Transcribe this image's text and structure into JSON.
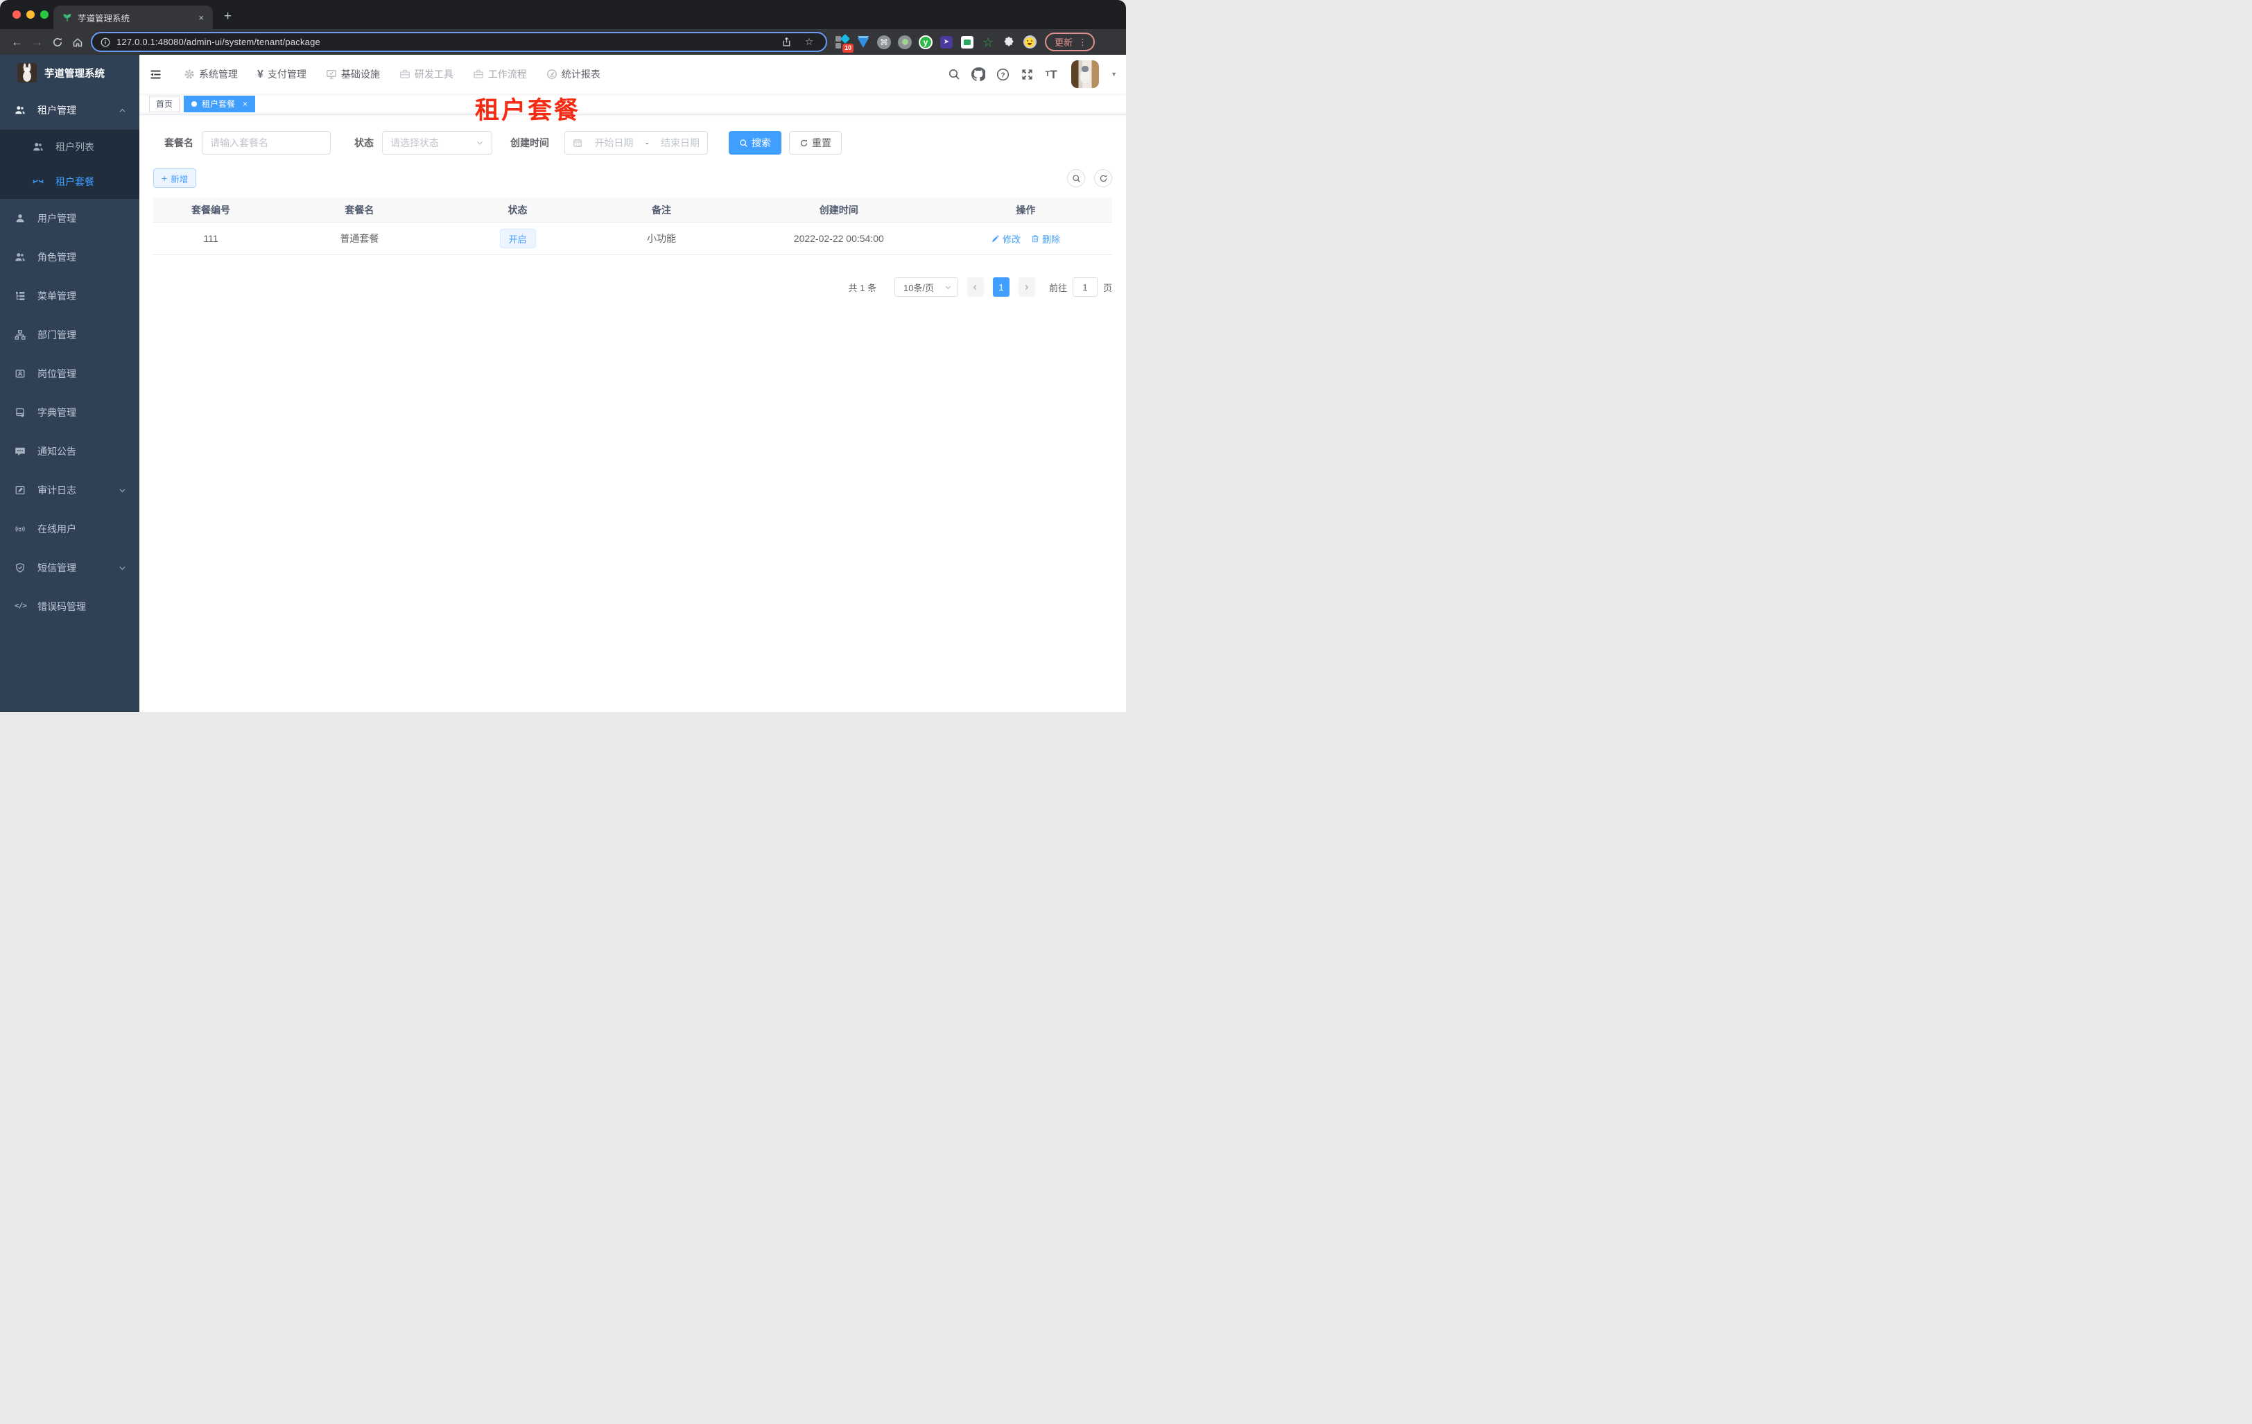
{
  "glyphs": {
    "close": "×",
    "plus": "+",
    "kebab": "⋮",
    "back": "←",
    "forward": "→",
    "caret": "▼",
    "command": "⌘",
    "star": "☆",
    "yen": "¥",
    "y": "y",
    "code": "</>",
    "hyphen": "-",
    "tt_small": "T",
    "tt_big": "T",
    "send": "➤",
    "puzzle": "◘",
    "question": "?"
  },
  "colors": {
    "accent": "#409eff",
    "sidebar_bg": "#304156",
    "submenu_bg": "#1f2d3d",
    "red_title": "#f42a12",
    "tag_active": "#409eff"
  },
  "browser": {
    "tab_title": "芋道管理系统",
    "url": "127.0.0.1:48080/admin-ui/system/tenant/package",
    "update_label": "更新",
    "extension_badge": "10"
  },
  "sidebar": {
    "logo_title": "芋道管理系统",
    "items": [
      {
        "label": "租户管理",
        "icon": "user-group-icon"
      },
      {
        "label": "租户列表",
        "icon": "user-group-icon"
      },
      {
        "label": "租户套餐",
        "icon": "closed-eyes-icon"
      },
      {
        "label": "用户管理",
        "icon": "user-icon"
      },
      {
        "label": "角色管理",
        "icon": "user-group-icon"
      },
      {
        "label": "菜单管理",
        "icon": "tree-list-icon"
      },
      {
        "label": "部门管理",
        "icon": "org-chart-icon"
      },
      {
        "label": "岗位管理",
        "icon": "id-badge-icon"
      },
      {
        "label": "字典管理",
        "icon": "dictionary-icon"
      },
      {
        "label": "通知公告",
        "icon": "message-icon"
      },
      {
        "label": "审计日志",
        "icon": "audit-log-icon"
      },
      {
        "label": "在线用户",
        "icon": "online-user-icon"
      },
      {
        "label": "短信管理",
        "icon": "shield-check-icon"
      },
      {
        "label": "错误码管理",
        "icon": "code-icon"
      }
    ]
  },
  "topnav": {
    "items": [
      {
        "label": "系统管理",
        "icon": "gear-icon"
      },
      {
        "label": "支付管理",
        "icon": "yen-icon"
      },
      {
        "label": "基础设施",
        "icon": "monitor-icon"
      },
      {
        "label": "研发工具",
        "icon": "toolbox-icon"
      },
      {
        "label": "工作流程",
        "icon": "toolbox-icon"
      },
      {
        "label": "统计报表",
        "icon": "dashboard-icon"
      }
    ]
  },
  "tags": {
    "home": "首页",
    "active": "租户套餐"
  },
  "overlay_title": "租户套餐",
  "filters": {
    "package_name_label": "套餐名",
    "package_name_placeholder": "请输入套餐名",
    "status_label": "状态",
    "status_placeholder": "请选择状态",
    "create_time_label": "创建时间",
    "start_placeholder": "开始日期",
    "end_placeholder": "结束日期",
    "search_label": "搜索",
    "reset_label": "重置"
  },
  "toolbar": {
    "add_label": "新增"
  },
  "table": {
    "headers": [
      "套餐编号",
      "套餐名",
      "状态",
      "备注",
      "创建时间",
      "操作"
    ],
    "rows": [
      {
        "id": "111",
        "name": "普通套餐",
        "status": "开启",
        "remark": "小功能",
        "created_at": "2022-02-22 00:54:00",
        "edit_label": "修改",
        "delete_label": "删除"
      }
    ]
  },
  "pagination": {
    "total": "共 1 条",
    "size": "10条/页",
    "page": "1",
    "goto_label": "前往",
    "goto_value": "1",
    "page_unit": "页"
  }
}
